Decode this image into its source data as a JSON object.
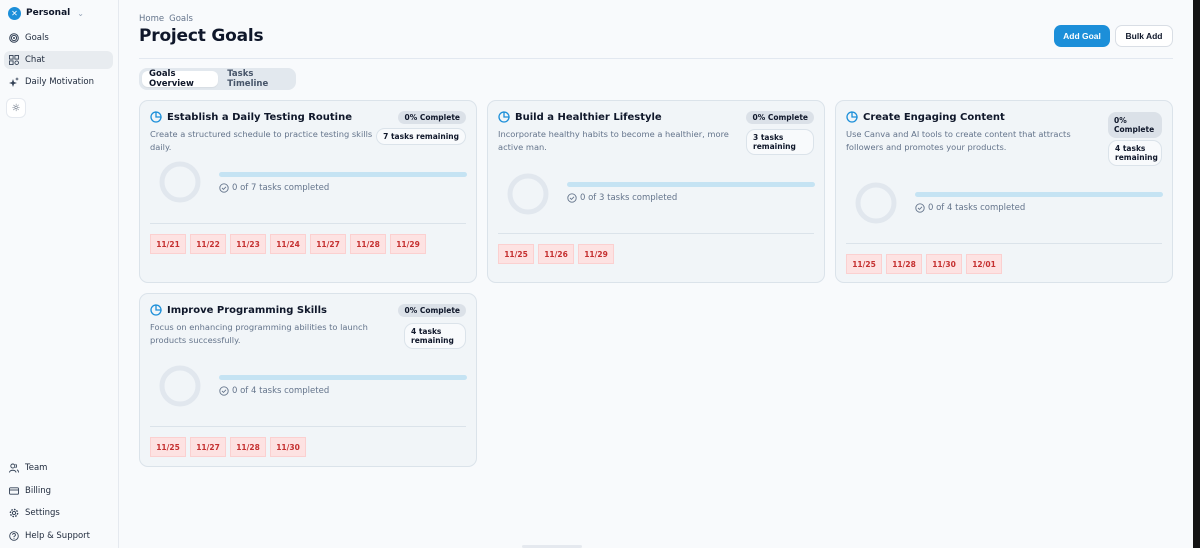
{
  "sidebar": {
    "workspace": {
      "name": "Personal",
      "icon": "workspace-logo-icon",
      "chevron": "chevron-down-icon"
    },
    "top_items": [
      {
        "label": "Goals",
        "icon": "target-icon",
        "active": false
      },
      {
        "label": "Chat",
        "icon": "grid-icon",
        "active": true
      },
      {
        "label": "Daily Motivation",
        "icon": "sparkles-icon",
        "active": false
      }
    ],
    "theme_toggle_icon": "sun-icon",
    "bottom_items": [
      {
        "label": "Team",
        "icon": "users-icon"
      },
      {
        "label": "Billing",
        "icon": "credit-card-icon"
      },
      {
        "label": "Settings",
        "icon": "gear-icon"
      },
      {
        "label": "Help & Support",
        "icon": "help-circle-icon"
      }
    ]
  },
  "header": {
    "breadcrumb": [
      "Home",
      "Goals"
    ],
    "title": "Project Goals",
    "add_goal_label": "Add Goal",
    "bulk_add_label": "Bulk Add"
  },
  "tabs": [
    {
      "label": "Goals Overview",
      "active": true
    },
    {
      "label": "Tasks Timeline",
      "active": false
    }
  ],
  "colors": {
    "accent": "#1c8fd9",
    "date_chip_bg": "#fde2e2",
    "date_chip_text": "#c53030"
  },
  "goals": [
    {
      "title": "Establish a Daily Testing Routine",
      "description": "Create a structured schedule to practice testing skills daily.",
      "percent_label": "0% Complete",
      "progress_percent": 0,
      "remaining_label": "7 tasks remaining",
      "completed_label": "0 of 7 tasks completed",
      "dates": [
        "11/21",
        "11/22",
        "11/23",
        "11/24",
        "11/27",
        "11/28",
        "11/29"
      ]
    },
    {
      "title": "Build a Healthier Lifestyle",
      "description": "Incorporate healthy habits to become a healthier, more active man.",
      "percent_label": "0% Complete",
      "progress_percent": 0,
      "remaining_label": "3 tasks remaining",
      "completed_label": "0 of 3 tasks completed",
      "dates": [
        "11/25",
        "11/26",
        "11/29"
      ]
    },
    {
      "title": "Create Engaging Content",
      "description": "Use Canva and AI tools to create content that attracts followers and promotes your products.",
      "percent_label": "0% Complete",
      "progress_percent": 0,
      "remaining_label": "4 tasks remaining",
      "completed_label": "0 of 4 tasks completed",
      "dates": [
        "11/25",
        "11/28",
        "11/30",
        "12/01"
      ]
    },
    {
      "title": "Improve Programming Skills",
      "description": "Focus on enhancing programming abilities to launch products successfully.",
      "percent_label": "0% Complete",
      "progress_percent": 0,
      "remaining_label": "4 tasks remaining",
      "completed_label": "0 of 4 tasks completed",
      "dates": [
        "11/25",
        "11/27",
        "11/28",
        "11/30"
      ]
    }
  ]
}
